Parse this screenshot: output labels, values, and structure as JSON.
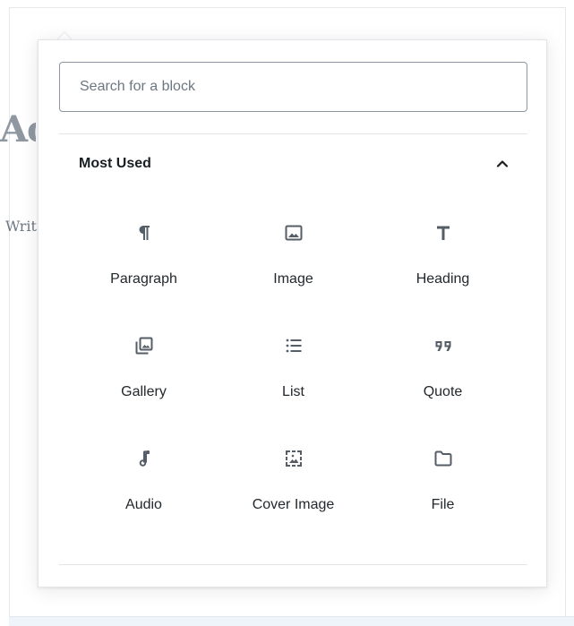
{
  "background": {
    "title_fragment": "Ac",
    "text_fragment": "Writ"
  },
  "inserter": {
    "search": {
      "placeholder": "Search for a block",
      "value": ""
    },
    "panel": {
      "title": "Most Used",
      "expanded": true
    },
    "blocks": [
      {
        "label": "Paragraph",
        "icon": "paragraph-icon"
      },
      {
        "label": "Image",
        "icon": "image-icon"
      },
      {
        "label": "Heading",
        "icon": "heading-icon"
      },
      {
        "label": "Gallery",
        "icon": "gallery-icon"
      },
      {
        "label": "List",
        "icon": "list-icon"
      },
      {
        "label": "Quote",
        "icon": "quote-icon"
      },
      {
        "label": "Audio",
        "icon": "audio-icon"
      },
      {
        "label": "Cover Image",
        "icon": "cover-image-icon"
      },
      {
        "label": "File",
        "icon": "file-icon"
      }
    ]
  },
  "colors": {
    "icon": "#555d66",
    "text": "#23282d",
    "border": "#e2e4e7",
    "input_border": "#8d96a0"
  }
}
